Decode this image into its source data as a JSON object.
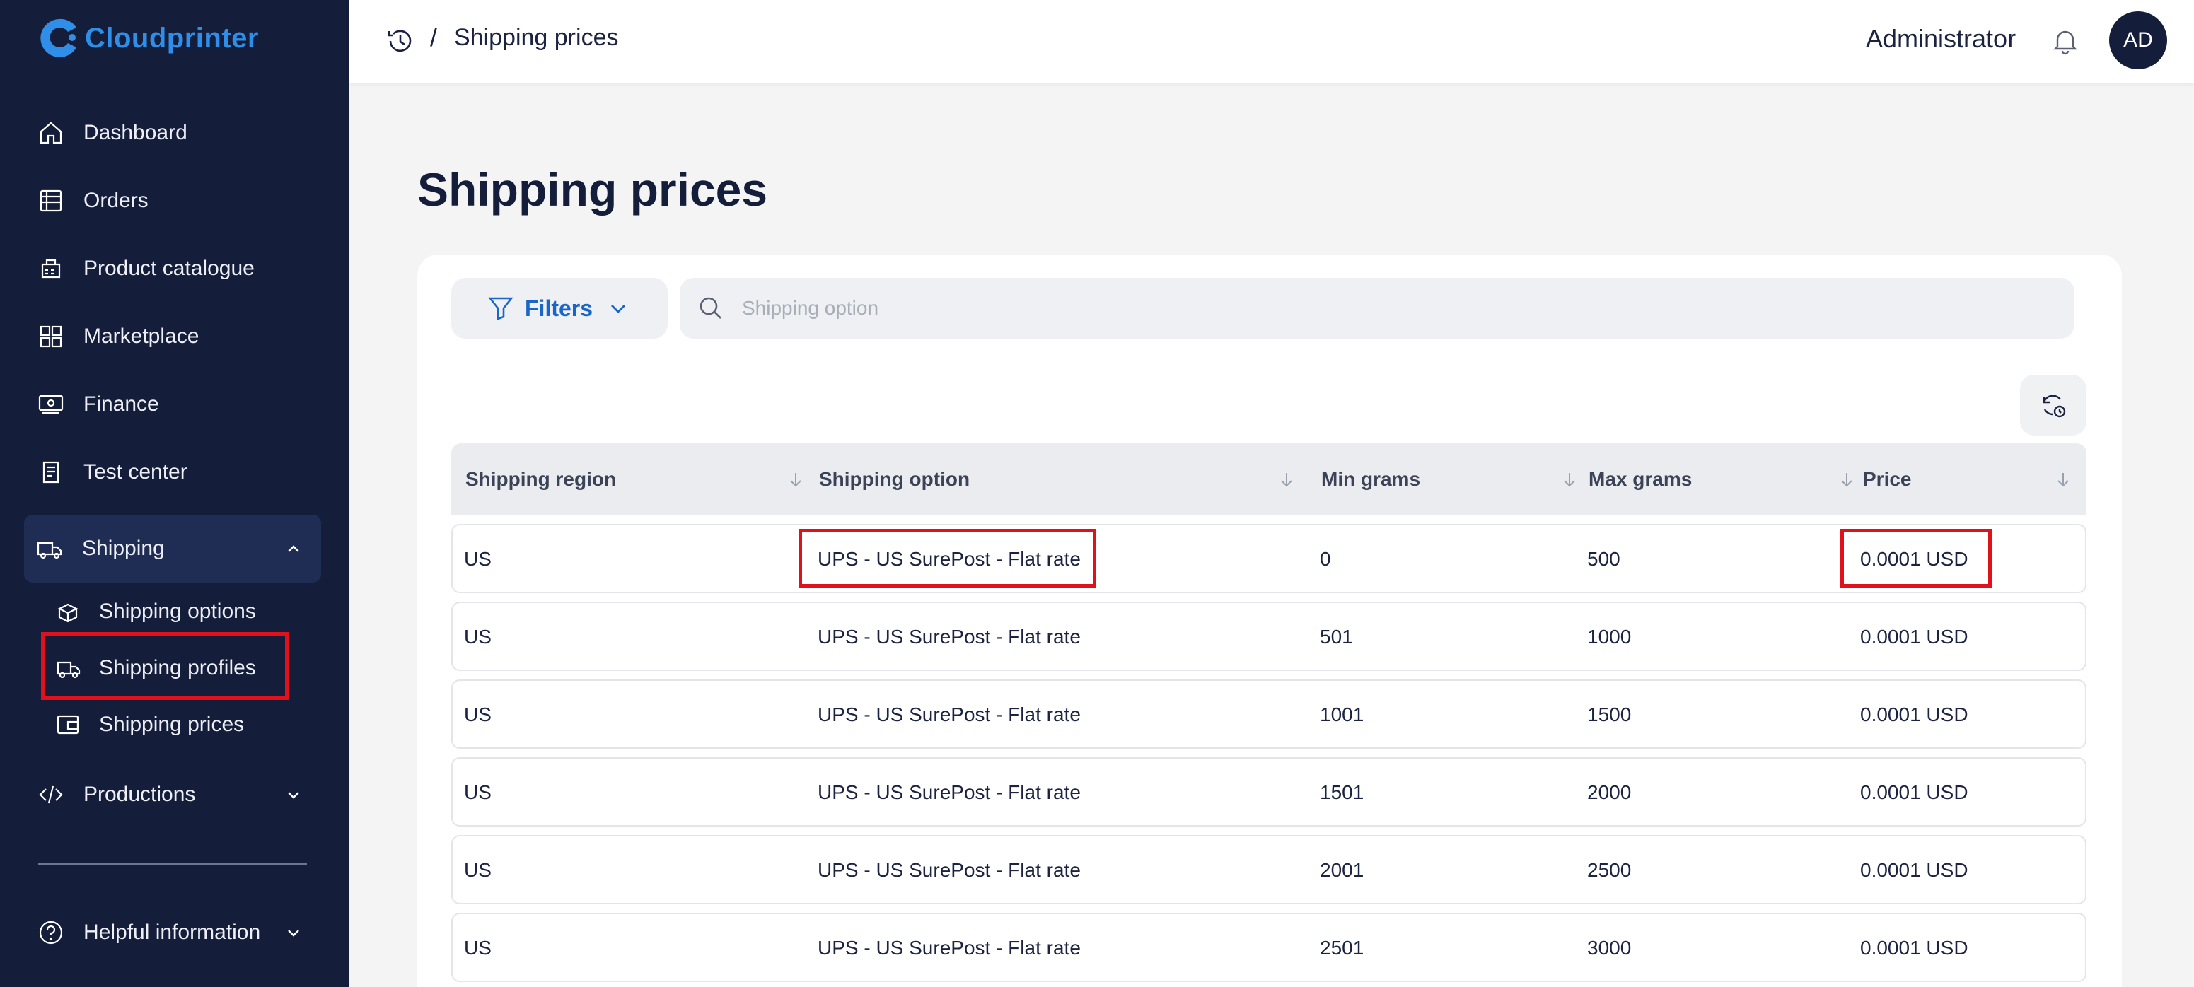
{
  "app": {
    "name": "Cloudprinter"
  },
  "sidebar": {
    "items": [
      {
        "label": "Dashboard",
        "icon": "home-icon"
      },
      {
        "label": "Orders",
        "icon": "orders-icon"
      },
      {
        "label": "Product catalogue",
        "icon": "product-catalogue-icon"
      },
      {
        "label": "Marketplace",
        "icon": "marketplace-icon"
      },
      {
        "label": "Finance",
        "icon": "finance-icon"
      },
      {
        "label": "Test center",
        "icon": "test-center-icon"
      }
    ],
    "shipping": {
      "label": "Shipping",
      "expanded": true,
      "sub_items": [
        {
          "label": "Shipping options"
        },
        {
          "label": "Shipping profiles",
          "highlighted": true
        },
        {
          "label": "Shipping prices"
        }
      ]
    },
    "productions": {
      "label": "Productions"
    },
    "helpful": {
      "label": "Helpful information"
    }
  },
  "topbar": {
    "breadcrumb_separator": "/",
    "breadcrumb_current": "Shipping prices",
    "user_name": "Administrator",
    "avatar_initials": "AD"
  },
  "page": {
    "title": "Shipping prices",
    "filters_label": "Filters",
    "search_placeholder": "Shipping option"
  },
  "table": {
    "columns": [
      "Shipping region",
      "Shipping option",
      "Min grams",
      "Max grams",
      "Price"
    ],
    "rows": [
      [
        "US",
        "UPS - US SurePost - Flat rate",
        "0",
        "500",
        "0.0001 USD"
      ],
      [
        "US",
        "UPS - US SurePost - Flat rate",
        "501",
        "1000",
        "0.0001 USD"
      ],
      [
        "US",
        "UPS - US SurePost - Flat rate",
        "1001",
        "1500",
        "0.0001 USD"
      ],
      [
        "US",
        "UPS - US SurePost - Flat rate",
        "1501",
        "2000",
        "0.0001 USD"
      ],
      [
        "US",
        "UPS - US SurePost - Flat rate",
        "2001",
        "2500",
        "0.0001 USD"
      ],
      [
        "US",
        "UPS - US SurePost - Flat rate",
        "2501",
        "3000",
        "0.0001 USD"
      ]
    ]
  },
  "colors": {
    "sidebar_bg": "#141d3a",
    "accent": "#1a66c8",
    "logo": "#2f8ee8",
    "highlight": "#e0111b"
  }
}
